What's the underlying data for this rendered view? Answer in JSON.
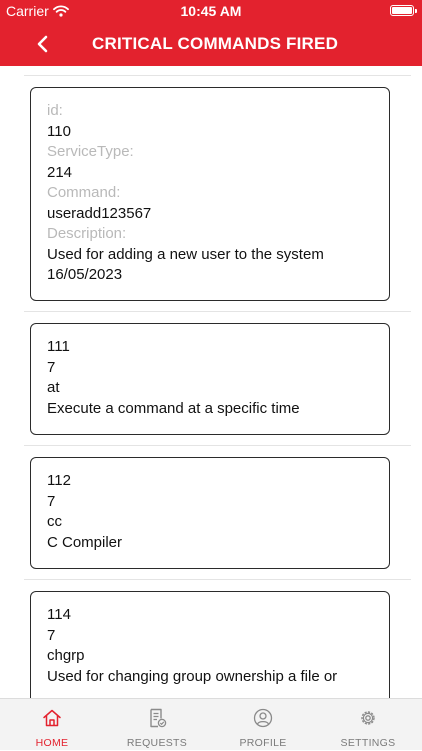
{
  "status_bar": {
    "carrier": "Carrier",
    "time": "10:45 AM",
    "wifi_icon": "wifi-icon",
    "battery_icon": "battery-icon"
  },
  "header": {
    "title": "CRITICAL COMMANDS FIRED",
    "back_icon": "chevron-left-icon",
    "color": "#e3222e"
  },
  "labels": {
    "id": "id:",
    "service_type": "ServiceType:",
    "command": "Command:",
    "description": "Description:"
  },
  "commands": [
    {
      "id": "110",
      "service_type": "214",
      "command": "useradd123567",
      "description": "Used for adding a new user to the system",
      "date": "16/05/2023"
    },
    {
      "id": "111",
      "service_type": "7",
      "command": "at",
      "description": "Execute a command at a specific time"
    },
    {
      "id": "112",
      "service_type": "7",
      "command": "cc",
      "description": "C Compiler"
    },
    {
      "id": "114",
      "service_type": "7",
      "command": "chgrp",
      "description": "Used for changing group ownership a file or"
    }
  ],
  "tabs": [
    {
      "label": "HOME",
      "icon": "home-icon",
      "active": true
    },
    {
      "label": "REQUESTS",
      "icon": "document-icon"
    },
    {
      "label": "PROFILE",
      "icon": "user-icon"
    },
    {
      "label": "SETTINGS",
      "icon": "gear-icon"
    }
  ]
}
